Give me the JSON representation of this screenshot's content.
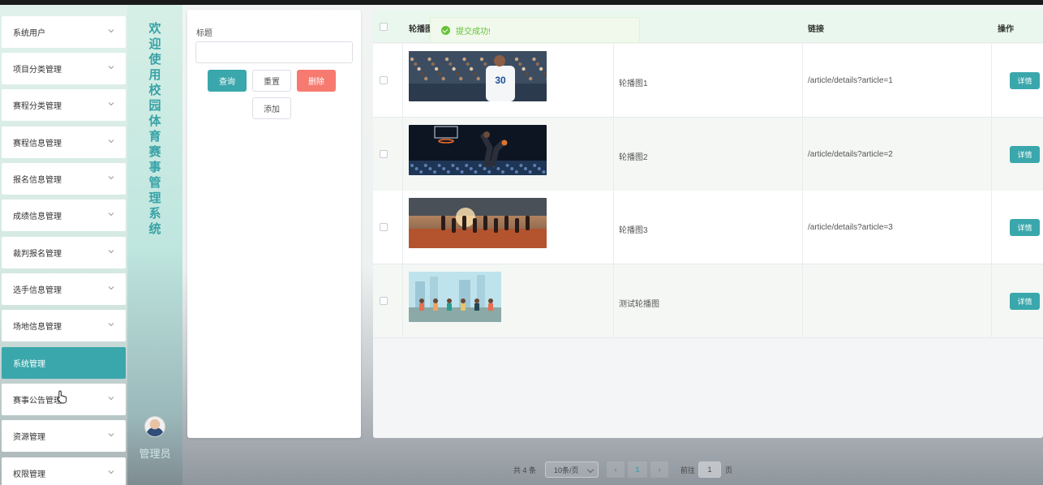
{
  "sidebar": {
    "items": [
      {
        "label": "系统用户"
      },
      {
        "label": "项目分类管理"
      },
      {
        "label": "赛程分类管理"
      },
      {
        "label": "赛程信息管理"
      },
      {
        "label": "报名信息管理"
      },
      {
        "label": "成绩信息管理"
      },
      {
        "label": "裁判报名管理"
      },
      {
        "label": "选手信息管理"
      },
      {
        "label": "场地信息管理"
      },
      {
        "label": "系统管理",
        "active": true
      },
      {
        "label": "赛事公告管理"
      },
      {
        "label": "资源管理"
      },
      {
        "label": "权限管理"
      }
    ]
  },
  "brand": {
    "chars": [
      "欢",
      "迎",
      "使",
      "用",
      "校",
      "园",
      "体",
      "育",
      "赛",
      "事",
      "管",
      "理",
      "系",
      "统"
    ],
    "user_label": "管理员"
  },
  "search": {
    "field_label": "标题",
    "input_value": "",
    "query_label": "查询",
    "reset_label": "重置",
    "delete_label": "删除",
    "add_label": "添加"
  },
  "table": {
    "headers": {
      "image": "轮播图",
      "link": "链接",
      "actions": "操作"
    },
    "rows": [
      {
        "title": "轮播图1",
        "link": "/article/details?article=1",
        "detail_label": "详情",
        "thumb": "basketball-player-30-icon"
      },
      {
        "title": "轮播图2",
        "link": "/article/details?article=2",
        "detail_label": "详情",
        "thumb": "basketball-dunk-icon"
      },
      {
        "title": "轮播图3",
        "link": "/article/details?article=3",
        "detail_label": "详情",
        "thumb": "track-runners-icon"
      },
      {
        "title": "测试轮播图",
        "link": "",
        "detail_label": "详情",
        "thumb": "cartoon-runners-icon"
      }
    ]
  },
  "toast": {
    "message": "提交成功!"
  },
  "pagination": {
    "total_text": "共 4 条",
    "page_size": "10条/页",
    "current_page": "1",
    "goto_label": "前往",
    "goto_value": "1",
    "page_unit": "页"
  },
  "colors": {
    "accent": "#3aa7ac",
    "danger": "#f67a6f",
    "success": "#67c23a"
  }
}
